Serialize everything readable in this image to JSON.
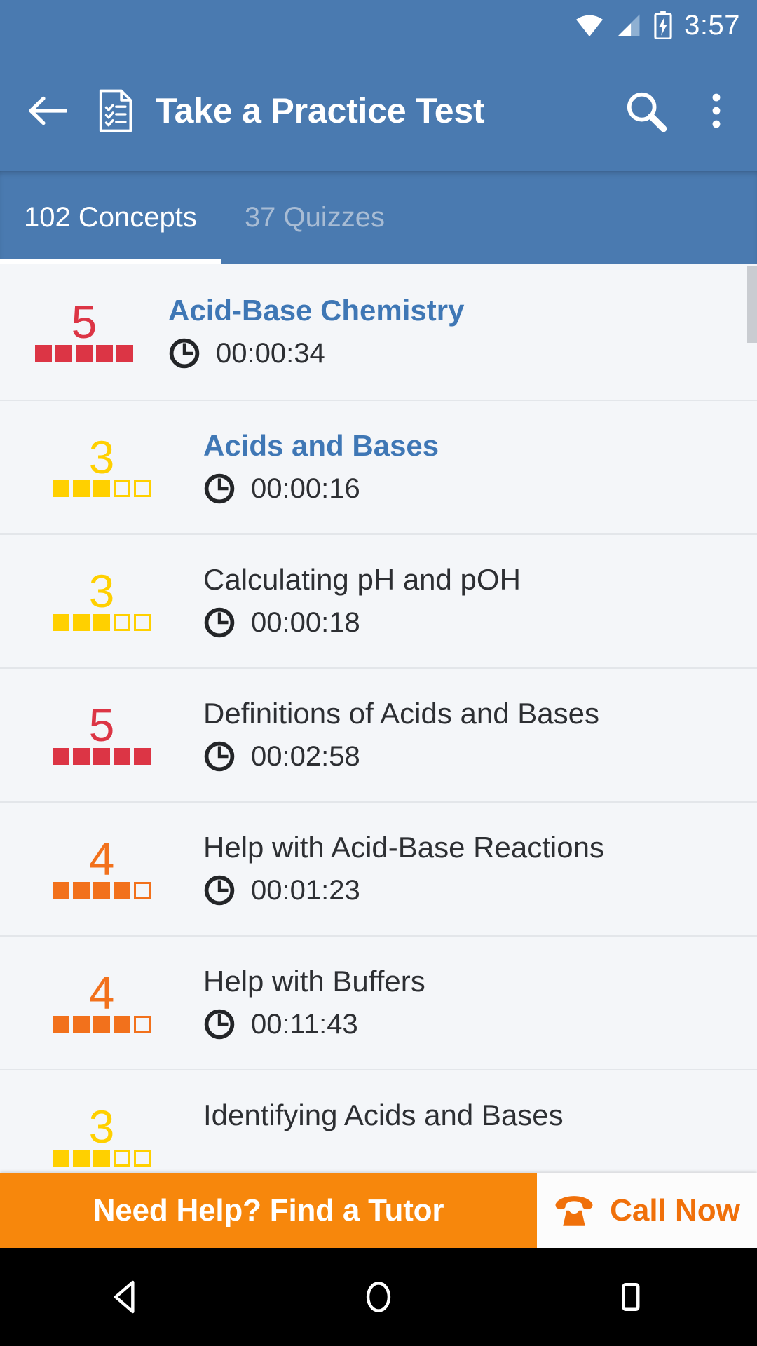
{
  "status_bar": {
    "time": "3:57",
    "icons": [
      "wifi-icon",
      "cell-signal-icon",
      "battery-charging-icon"
    ]
  },
  "app_bar": {
    "back_icon": "back-arrow-icon",
    "doc_icon": "practice-test-document-icon",
    "title": "Take a Practice Test",
    "search_icon": "search-icon",
    "overflow_icon": "overflow-menu-icon"
  },
  "tabs": [
    {
      "label": "102 Concepts",
      "active": true
    },
    {
      "label": "37 Quizzes",
      "active": false
    }
  ],
  "colors": {
    "appbar": "#4a7ab0",
    "tab_active_text": "#ffffff",
    "tab_inactive_text": "#a8bcd4",
    "link": "#3f77b5",
    "plain_text": "#2d2f33",
    "rating_red": "#dc3545",
    "rating_orange": "#f2711c",
    "rating_yellow": "#ffd000",
    "banner_orange": "#f7870c",
    "call_orange": "#f0700a",
    "list_bg": "#f4f6f9",
    "divider": "#e3e6ea"
  },
  "list": {
    "clock_icon": "clock-icon",
    "scrollbar": "scroll-thumb",
    "items": [
      {
        "rating": "5",
        "rating_filled": 5,
        "rating_total": 5,
        "rating_color": "#dc3545",
        "title": "Acid-Base Chemistry",
        "visited": true,
        "time": "00:00:34",
        "indent": false
      },
      {
        "rating": "3",
        "rating_filled": 3,
        "rating_total": 5,
        "rating_color": "#ffd000",
        "title": "Acids and Bases",
        "visited": true,
        "time": "00:00:16",
        "indent": true
      },
      {
        "rating": "3",
        "rating_filled": 3,
        "rating_total": 5,
        "rating_color": "#ffd000",
        "title": "Calculating pH and pOH",
        "visited": false,
        "time": "00:00:18",
        "indent": true
      },
      {
        "rating": "5",
        "rating_filled": 5,
        "rating_total": 5,
        "rating_color": "#dc3545",
        "title": "Definitions of Acids and Bases",
        "visited": false,
        "time": "00:02:58",
        "indent": true
      },
      {
        "rating": "4",
        "rating_filled": 4,
        "rating_total": 5,
        "rating_color": "#f2711c",
        "title": "Help with Acid-Base Reactions",
        "visited": false,
        "time": "00:01:23",
        "indent": true
      },
      {
        "rating": "4",
        "rating_filled": 4,
        "rating_total": 5,
        "rating_color": "#f2711c",
        "title": "Help with Buffers",
        "visited": false,
        "time": "00:11:43",
        "indent": true
      },
      {
        "rating": "3",
        "rating_filled": 3,
        "rating_total": 5,
        "rating_color": "#ffd000",
        "title": "Identifying Acids and Bases",
        "visited": false,
        "time": "",
        "indent": true
      }
    ]
  },
  "banner": {
    "main_label": "Need Help? Find a Tutor",
    "phone_icon": "telephone-icon",
    "call_label": "Call Now"
  },
  "nav_bar": {
    "back": "nav-back-icon",
    "home": "nav-home-icon",
    "recents": "nav-recents-icon"
  }
}
